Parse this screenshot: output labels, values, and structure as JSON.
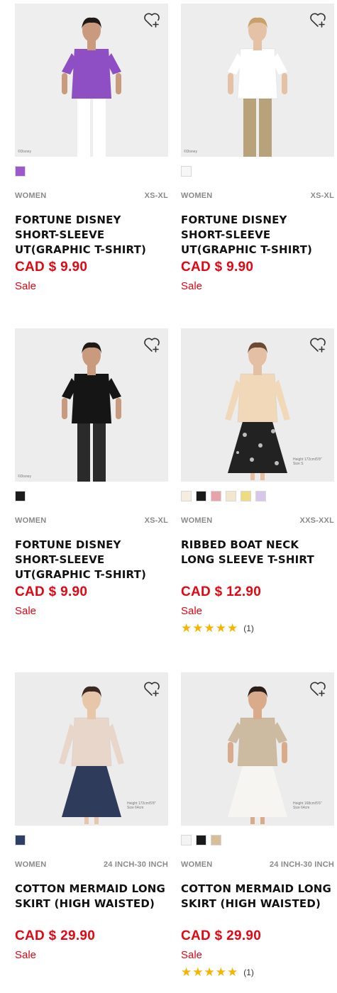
{
  "products": [
    {
      "name": "FORTUNE DISNEY SHORT-SLEEVE UT(GRAPHIC T-SHIRT)",
      "gender": "WOMEN",
      "sizes": "XS-XL",
      "price": "CAD $ 9.90",
      "sale": "Sale",
      "photo_note": "©Disney",
      "image": "model-purple-tshirt",
      "colors": [
        "#9b59c9"
      ],
      "rating": null
    },
    {
      "name": "FORTUNE DISNEY SHORT-SLEEVE UT(GRAPHIC T-SHIRT)",
      "gender": "WOMEN",
      "sizes": "XS-XL",
      "price": "CAD $ 9.90",
      "sale": "Sale",
      "photo_note": "©Disney",
      "image": "model-white-tshirt",
      "colors": [
        "#f7f7f7"
      ],
      "rating": null
    },
    {
      "name": "FORTUNE DISNEY SHORT-SLEEVE UT(GRAPHIC T-SHIRT)",
      "gender": "WOMEN",
      "sizes": "XS-XL",
      "price": "CAD $ 9.90",
      "sale": "Sale",
      "photo_note": "©Disney",
      "image": "model-black-tshirt",
      "colors": [
        "#1c1c1c"
      ],
      "rating": null
    },
    {
      "name": "RIBBED BOAT NECK LONG SLEEVE T-SHIRT",
      "gender": "WOMEN",
      "sizes": "XXS-XXL",
      "price": "CAD $ 12.90",
      "sale": "Sale",
      "photo_note": "Height 172cm/5'8\" Size S",
      "image": "model-beige-longsleeve",
      "colors": [
        "#f4ede0",
        "#1a1a1a",
        "#e7a3a9",
        "#f3e6cf",
        "#eedc83",
        "#d8c7ea"
      ],
      "rating": {
        "stars": "★★★★★",
        "count": "(1)"
      }
    },
    {
      "name": "COTTON MERMAID LONG SKIRT (HIGH WAISTED)",
      "gender": "WOMEN",
      "sizes": "24 INCH-30 INCH",
      "price": "CAD $ 29.90",
      "sale": "Sale",
      "photo_note": "Height 172cm/5'8\" Size 64cm",
      "image": "model-navy-skirt",
      "colors": [
        "#2e3f66"
      ],
      "rating": null
    },
    {
      "name": "COTTON MERMAID LONG SKIRT (HIGH WAISTED)",
      "gender": "WOMEN",
      "sizes": "24 INCH-30 INCH",
      "price": "CAD $ 29.90",
      "sale": "Sale",
      "photo_note": "Height 168cm/5'6\" Size 64cm",
      "image": "model-white-skirt",
      "colors": [
        "#f4f4f4",
        "#1a1a1a",
        "#d7be9a"
      ],
      "rating": {
        "stars": "★★★★★",
        "count": "(1)"
      }
    }
  ],
  "wishlist_icon": "heart-plus-icon"
}
